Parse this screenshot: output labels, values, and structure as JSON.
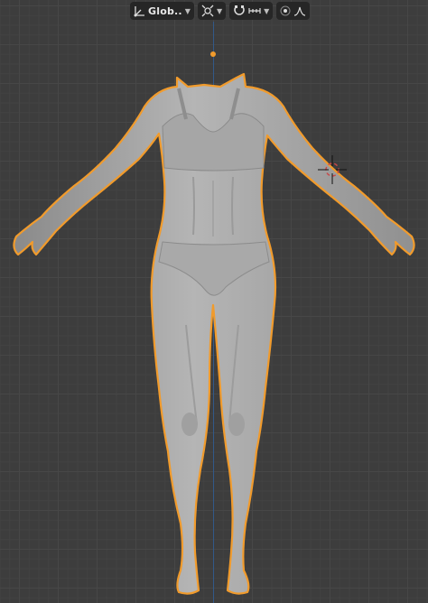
{
  "header": {
    "orientation_label": "Glob..",
    "icons": [
      "transform-orientation-icon",
      "pivot-point-icon",
      "snap-icon",
      "snap-increment-icon",
      "proportional-editing-icon",
      "proportional-falloff-icon"
    ]
  },
  "viewport": {
    "grid_color": "#474747",
    "background": "#3d3d3d",
    "selection_outline": "#f19b2c",
    "object": "female-base-mesh"
  }
}
